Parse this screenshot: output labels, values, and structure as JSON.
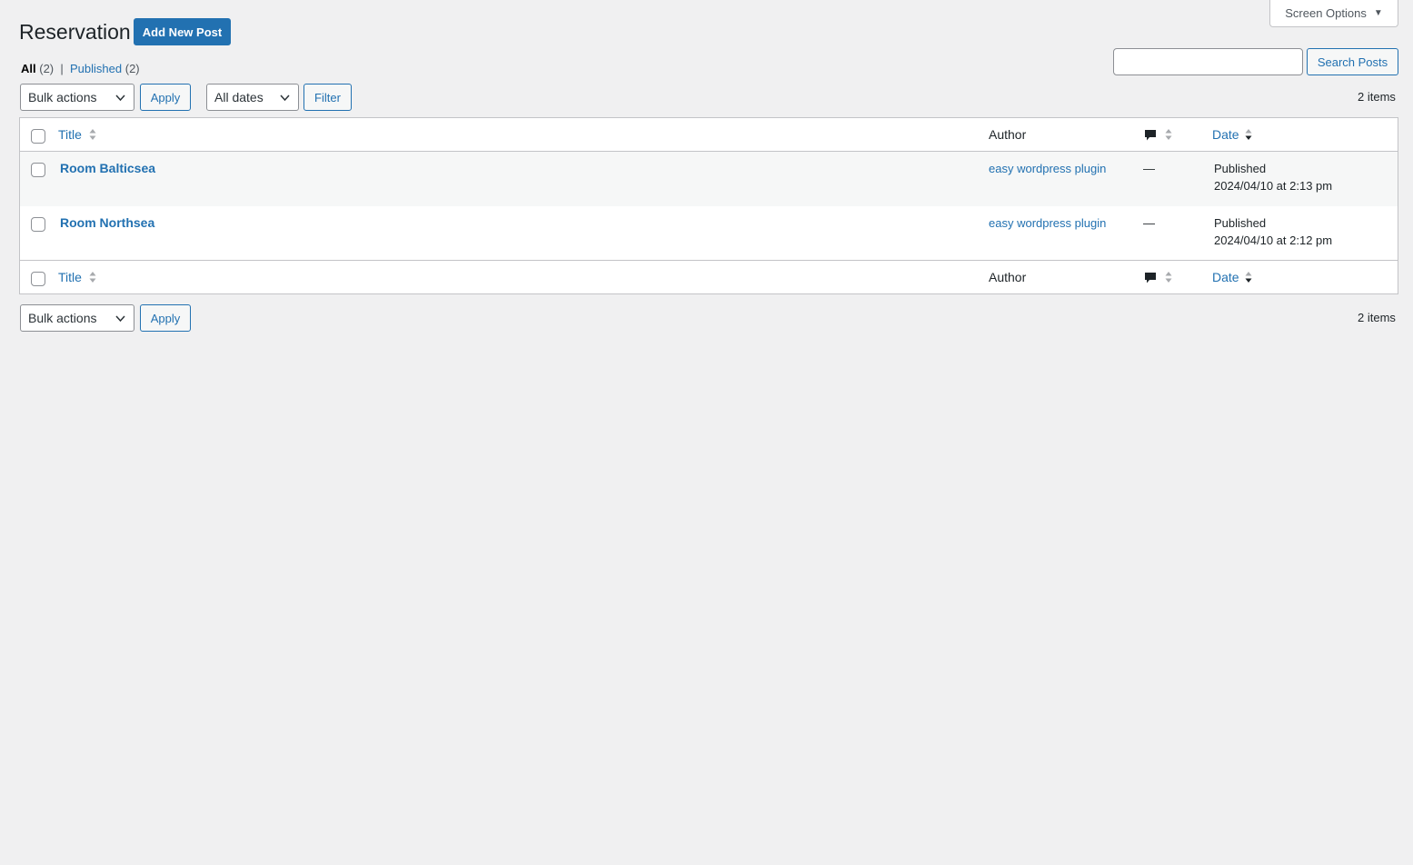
{
  "screen_options": {
    "label": "Screen Options"
  },
  "header": {
    "title": "Reservation",
    "add_new_label": "Add New Post"
  },
  "views": {
    "all_label": "All",
    "all_count": "(2)",
    "separator": "|",
    "published_label": "Published",
    "published_count": "(2)"
  },
  "search": {
    "value": "",
    "button_label": "Search Posts"
  },
  "top_nav": {
    "bulk_actions": "Bulk actions",
    "apply_label": "Apply",
    "date_filter": "All dates",
    "filter_label": "Filter",
    "items_count": "2 items"
  },
  "table": {
    "columns": {
      "title": "Title",
      "author": "Author",
      "date": "Date"
    },
    "rows": [
      {
        "title": "Room Balticsea",
        "author": "easy wordpress plugin",
        "comments": "—",
        "status": "Published",
        "date": "2024/04/10 at 2:13 pm"
      },
      {
        "title": "Room Northsea",
        "author": "easy wordpress plugin",
        "comments": "—",
        "status": "Published",
        "date": "2024/04/10 at 2:12 pm"
      }
    ]
  },
  "bottom_nav": {
    "bulk_actions": "Bulk actions",
    "apply_label": "Apply",
    "items_count": "2 items"
  },
  "icons": {
    "comment": "comment-bubble-icon",
    "sort": "sort-arrows-icon",
    "chevron": "chevron-down-icon"
  },
  "colors": {
    "accent": "#2271b1",
    "background": "#f0f0f1",
    "alt_row": "#f6f7f7"
  }
}
